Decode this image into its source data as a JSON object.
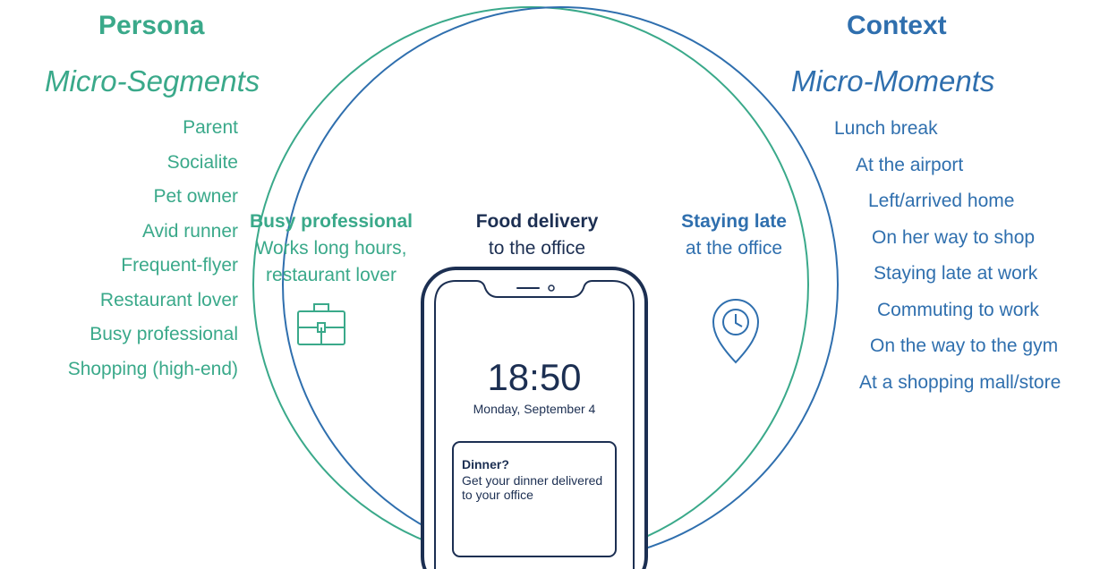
{
  "persona": {
    "title": "Persona",
    "subtitle": "Micro-Segments",
    "items": [
      "Parent",
      "Socialite",
      "Pet owner",
      "Avid runner",
      "Frequent-flyer",
      "Restaurant lover",
      "Busy professional",
      "Shopping (high-end)"
    ]
  },
  "context": {
    "title": "Context",
    "subtitle": "Micro-Moments",
    "items": [
      "Lunch break",
      "At the airport",
      "Left/arrived home",
      "On her way to shop",
      "Staying late at work",
      "Commuting to work",
      "On the way to the gym",
      "At a shopping mall/store"
    ]
  },
  "left_circle": {
    "heading": "Busy professional",
    "line1": "Works long hours,",
    "line2": "restaurant lover",
    "icon": "briefcase-icon"
  },
  "intersection": {
    "heading": "Food delivery",
    "line1": "to the office"
  },
  "right_circle": {
    "heading": "Staying late",
    "line1": "at the office",
    "icon": "location-clock-icon"
  },
  "phone": {
    "time": "18:50",
    "date": "Monday, September 4",
    "notification": {
      "title": "Dinner?",
      "body": "Get your dinner delivered to your office"
    }
  },
  "colors": {
    "persona": "#3aa98a",
    "context": "#2f6fae",
    "phone": "#1c2f52"
  }
}
